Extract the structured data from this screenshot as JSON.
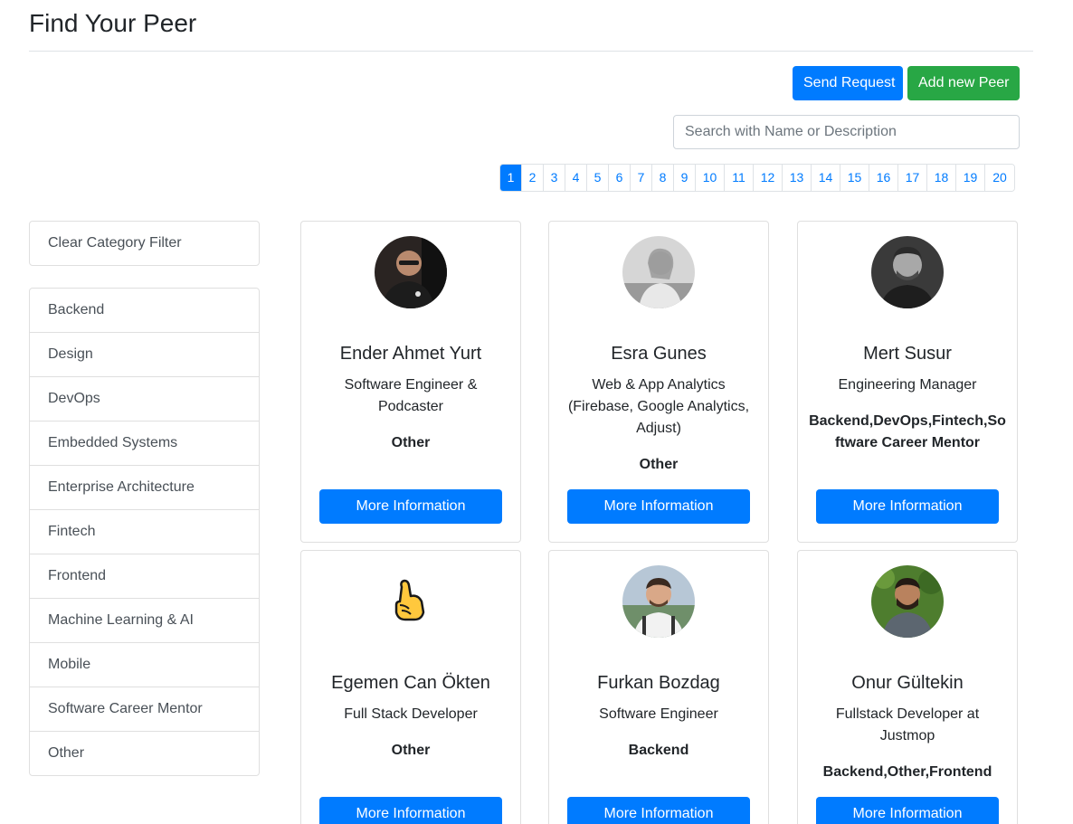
{
  "page_title": "Find Your Peer",
  "buttons": {
    "send_request": "Send Request",
    "add_new_peer": "Add new Peer"
  },
  "search": {
    "placeholder": "Search with Name or Description",
    "value": ""
  },
  "pagination": {
    "active": "1",
    "pages": [
      "1",
      "2",
      "3",
      "4",
      "5",
      "6",
      "7",
      "8",
      "9",
      "10",
      "11",
      "12",
      "13",
      "14",
      "15",
      "16",
      "17",
      "18",
      "19",
      "20"
    ]
  },
  "sidebar": {
    "clear_filter": "Clear Category Filter",
    "categories": [
      "Backend",
      "Design",
      "DevOps",
      "Embedded Systems",
      "Enterprise Architecture",
      "Fintech",
      "Frontend",
      "Machine Learning & AI",
      "Mobile",
      "Software Career Mentor",
      "Other"
    ]
  },
  "card_button_label": "More Information",
  "peers": [
    {
      "name": "Ender Ahmet Yurt",
      "description": "Software Engineer & Podcaster",
      "categories": "Other",
      "avatar": "photo-dark-glasses"
    },
    {
      "name": "Esra Gunes",
      "description": "Web & App Analytics (Firebase, Google Analytics, Adjust)",
      "categories": "Other",
      "avatar": "photo-grayscale-woman"
    },
    {
      "name": "Mert Susur",
      "description": "Engineering Manager",
      "categories": "Backend,DevOps,Fintech,Software Career Mentor",
      "avatar": "photo-grayscale-man"
    },
    {
      "name": "Egemen Can Ökten",
      "description": "Full Stack Developer",
      "categories": "Other",
      "avatar": "call-me-hand-emoji"
    },
    {
      "name": "Furkan Bozdag",
      "description": "Software Engineer",
      "categories": "Backend",
      "avatar": "photo-outdoor-man"
    },
    {
      "name": "Onur Gültekin",
      "description": "Fullstack Developer at Justmop",
      "categories": "Backend,Other,Frontend",
      "avatar": "photo-green-background"
    }
  ]
}
